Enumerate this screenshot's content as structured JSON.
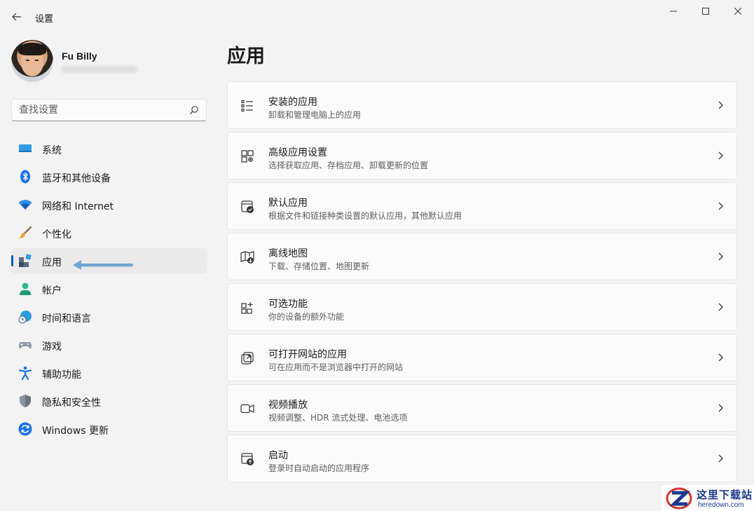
{
  "window": {
    "title": "设置"
  },
  "profile": {
    "name": "Fu Billy"
  },
  "search": {
    "placeholder": "查找设置"
  },
  "nav": {
    "items": [
      {
        "label": "系统",
        "icon": "monitor-icon"
      },
      {
        "label": "蓝牙和其他设备",
        "icon": "bluetooth-icon"
      },
      {
        "label": "网络和 Internet",
        "icon": "wifi-icon"
      },
      {
        "label": "个性化",
        "icon": "brush-icon"
      },
      {
        "label": "应用",
        "icon": "apps-icon",
        "selected": true
      },
      {
        "label": "帐户",
        "icon": "person-icon"
      },
      {
        "label": "时间和语言",
        "icon": "globe-clock-icon"
      },
      {
        "label": "游戏",
        "icon": "gamepad-icon"
      },
      {
        "label": "辅助功能",
        "icon": "accessibility-icon"
      },
      {
        "label": "隐私和安全性",
        "icon": "shield-icon"
      },
      {
        "label": "Windows 更新",
        "icon": "update-icon"
      }
    ]
  },
  "main": {
    "title": "应用",
    "cards": [
      {
        "title": "安装的应用",
        "subtitle": "卸载和管理电脑上的应用",
        "icon": "list-icon"
      },
      {
        "title": "高级应用设置",
        "subtitle": "选择获取应用、存档应用、卸载更新的位置",
        "icon": "app-settings-icon"
      },
      {
        "title": "默认应用",
        "subtitle": "根据文件和链接种类设置的默认应用，其他默认应用",
        "icon": "default-apps-icon"
      },
      {
        "title": "离线地图",
        "subtitle": "下载、存储位置、地图更新",
        "icon": "map-icon"
      },
      {
        "title": "可选功能",
        "subtitle": "你的设备的额外功能",
        "icon": "optional-features-icon"
      },
      {
        "title": "可打开网站的应用",
        "subtitle": "可在应用而不是浏览器中打开的网站",
        "icon": "open-link-icon"
      },
      {
        "title": "视频播放",
        "subtitle": "视频调整、HDR 流式处理、电池选项",
        "icon": "video-icon"
      },
      {
        "title": "启动",
        "subtitle": "登录时自动启动的应用程序",
        "icon": "startup-icon"
      }
    ]
  },
  "watermark": {
    "name": "这里下载站",
    "url": "heredown.com"
  },
  "colors": {
    "accent": "#005fb8",
    "arrow": "#6fa6d4",
    "background": "#f3f3f3",
    "card": "#fbfbfb"
  }
}
